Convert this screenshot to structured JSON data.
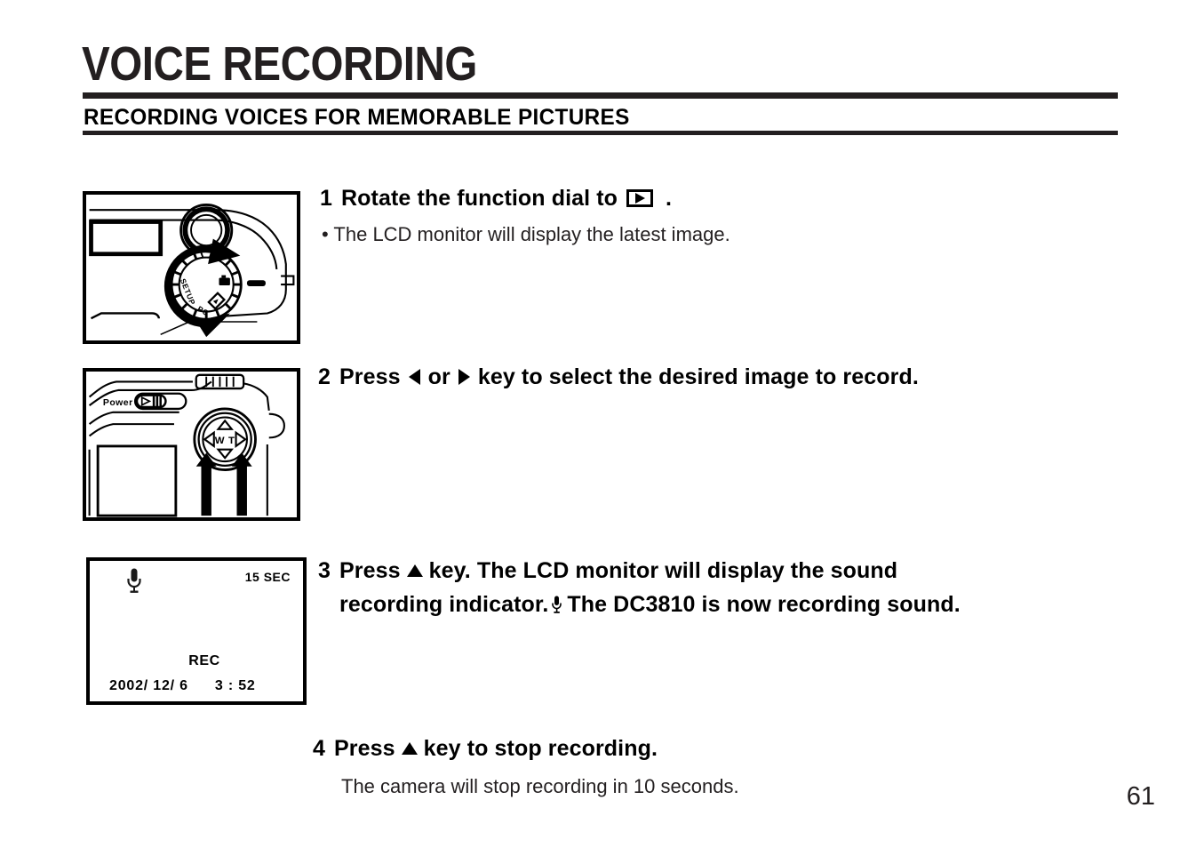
{
  "header": {
    "title": "VOICE RECORDING",
    "subtitle": "RECORDING VOICES FOR MEMORABLE PICTURES"
  },
  "steps": [
    {
      "number": "1",
      "head_before": "Rotate the function dial to",
      "icon": "playback-icon",
      "head_after": ".",
      "body": "• The LCD monitor will display the latest image."
    },
    {
      "number": "2",
      "head_before": "Press",
      "icon_left": "left-arrow-icon",
      "middle": "or",
      "icon_right": "right-arrow-icon",
      "head_after": "key to select the desired image to record."
    },
    {
      "number": "3",
      "head_before": "Press",
      "icon_up": "up-arrow-icon",
      "head_after": "key. The LCD monitor will display the sound",
      "line2_before": "recording indicator.",
      "icon_mic": "microphone-icon",
      "line2_after": "The DC3810 is now recording sound."
    },
    {
      "number": "4",
      "head_before": "Press",
      "icon_up": "up-arrow-icon",
      "head_after": "key to stop recording.",
      "body": "The camera will stop recording in 10 seconds."
    }
  ],
  "figures": {
    "dial": {
      "caption": "Camera top view with function dial",
      "dial_labels": [
        "SETUP",
        "PC"
      ],
      "dial_icons": [
        "camera-icon",
        "playback-icon"
      ]
    },
    "keys": {
      "caption": "Camera rear view with four-way key",
      "power_label": "Power",
      "wide_label": "W",
      "tele_label": "T"
    },
    "lcd": {
      "mic_icon": "microphone-icon",
      "duration": "15 SEC",
      "rec_label": "REC",
      "date": "2002/ 12/ 6",
      "time": "3 : 52"
    }
  },
  "page_number": "61",
  "colors": {
    "ink": "#231f20",
    "black": "#000000",
    "paper": "#ffffff"
  }
}
